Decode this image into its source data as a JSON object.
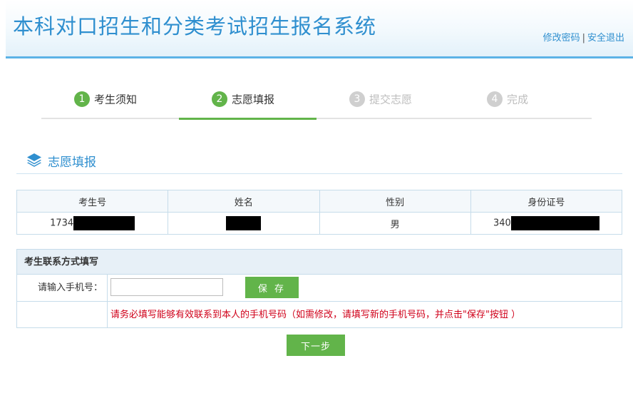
{
  "header": {
    "title": "本科对口招生和分类考试招生报名系统",
    "links": {
      "change_password": "修改密码",
      "separator": "|",
      "logout": "安全退出"
    }
  },
  "steps": [
    {
      "num": "1",
      "label": "考生须知",
      "state": "done"
    },
    {
      "num": "2",
      "label": "志愿填报",
      "state": "active"
    },
    {
      "num": "3",
      "label": "提交志愿",
      "state": "todo"
    },
    {
      "num": "4",
      "label": "完成",
      "state": "todo"
    }
  ],
  "section": {
    "title": "志愿填报",
    "icon": "layers-icon"
  },
  "info_table": {
    "headers": [
      "考生号",
      "姓名",
      "性别",
      "身份证号"
    ],
    "row": {
      "exam_no": "1734",
      "name": "",
      "gender": "男",
      "id_no": "340"
    }
  },
  "contact": {
    "heading": "考生联系方式填写",
    "phone_label": "请输入手机号：",
    "phone_value": "",
    "save_label": "保 存",
    "note": "请务必填写能够有效联系到本人的手机号码（如需修改，请填写新的手机号码，并点击\"保存\"按钮 ）"
  },
  "next_label": "下一步",
  "colors": {
    "primary_blue": "#2f8fcf",
    "green": "#62b44a",
    "warning_red": "#d0021b",
    "border": "#c6dcea"
  }
}
